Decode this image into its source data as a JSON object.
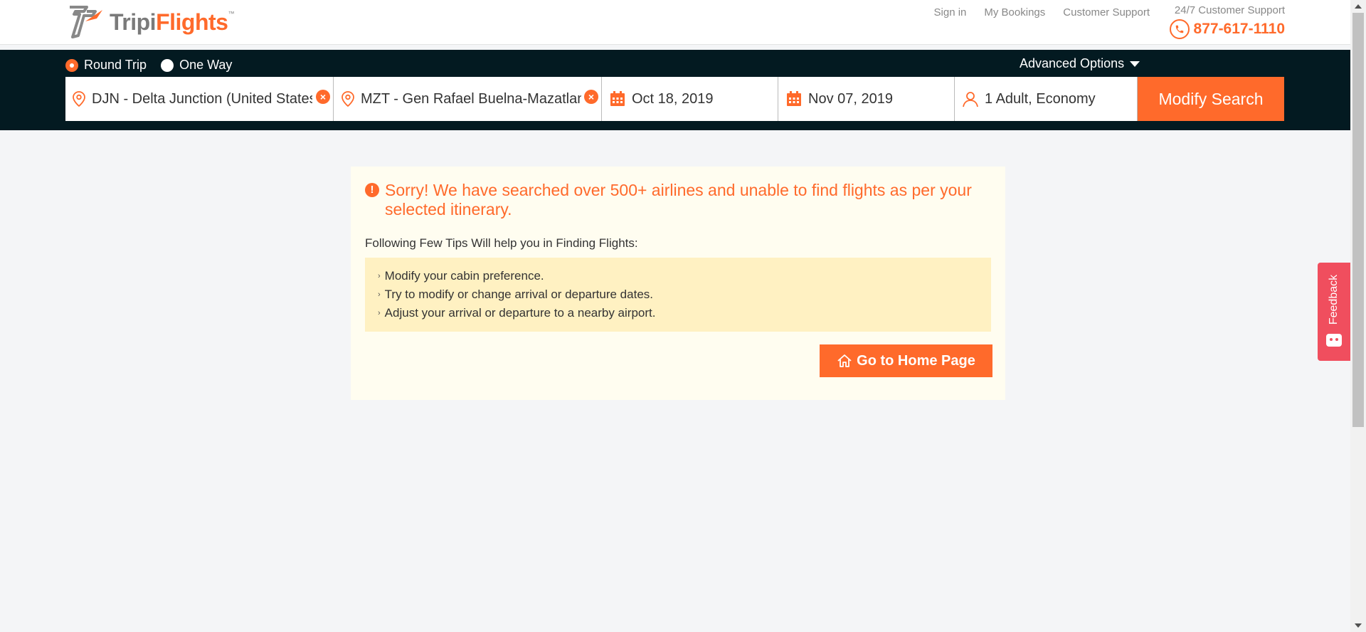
{
  "header": {
    "logo": {
      "part1": "Tripi",
      "part2": "Flights",
      "tm": "™"
    },
    "links": [
      "Sign in",
      "My Bookings",
      "Customer Support"
    ],
    "support_label": "24/7 Customer Support",
    "support_phone": "877-617-1110"
  },
  "search": {
    "trip_types": [
      {
        "label": "Round Trip",
        "selected": true
      },
      {
        "label": "One Way",
        "selected": false
      }
    ],
    "advanced_label": "Advanced Options",
    "from": "DJN - Delta Junction (United States)",
    "to": "MZT - Gen Rafael Buelna-Mazatlan",
    "depart": "Oct 18, 2019",
    "return": "Nov 07, 2019",
    "passengers": "1 Adult, Economy",
    "modify_label": "Modify Search"
  },
  "message": {
    "title": "Sorry! We have searched over 500+ airlines and unable to find flights as per your selected itinerary.",
    "tips_title": "Following Few Tips Will help you in Finding Flights:",
    "tips": [
      "Modify your cabin preference.",
      "Try to modify or change arrival or departure dates.",
      "Adjust your arrival or departure to a nearby airport."
    ],
    "home_button": "Go to Home Page"
  },
  "feedback": {
    "label": "Feedback"
  },
  "colors": {
    "accent": "#ff6a2b",
    "searchbar": "#031a21",
    "feedback": "#f04e5e",
    "card": "#fffdf0",
    "tips_bg": "#fff1c2"
  },
  "icons": [
    "logo-mark",
    "phone-icon",
    "location-pin-icon",
    "clear-icon",
    "calendar-icon",
    "user-icon",
    "home-icon",
    "alert-icon",
    "caret-down-icon",
    "feedback-face-icon"
  ]
}
